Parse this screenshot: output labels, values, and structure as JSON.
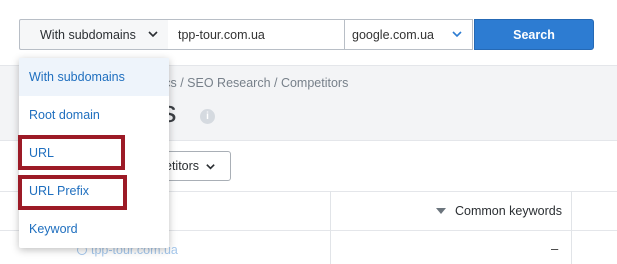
{
  "search_bar": {
    "scope_value": "With subdomains",
    "domain_value": "tpp-tour.com.ua",
    "database_value": "google.com.ua",
    "search_label": "Search"
  },
  "scope_options": [
    {
      "label": "With subdomains",
      "selected": true
    },
    {
      "label": "Root domain",
      "selected": false
    },
    {
      "label": "URL",
      "selected": false
    },
    {
      "label": "URL Prefix",
      "selected": false
    },
    {
      "label": "Keyword",
      "selected": false
    }
  ],
  "page": {
    "breadcrumb_visible": "tics / SEO Research / Competitors",
    "title_visible": "s",
    "info_icon": "i"
  },
  "toolbar": {
    "competitors_button_label": "etitors"
  },
  "table": {
    "column_header": "Common keywords",
    "rows": [
      {
        "domain": "tpp-tour.com.ua",
        "common_keywords": "–"
      }
    ]
  },
  "annotations": {
    "highlight_color": "#9c1a26",
    "highlighted_options": [
      "URL",
      "URL Prefix"
    ]
  },
  "colors": {
    "accent": "#2d7cd2",
    "link": "#1f6fbf"
  }
}
